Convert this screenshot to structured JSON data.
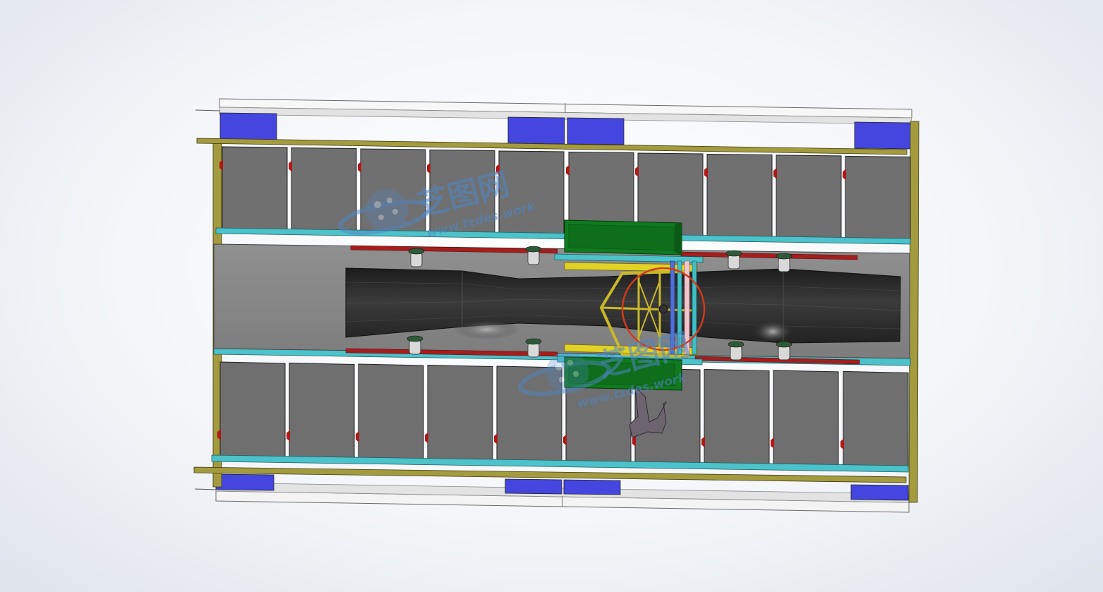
{
  "viewport": {
    "background": "#f4f6f9",
    "colors": {
      "frame_olive": "#a19a3c",
      "rail_cyan": "#4bc0c8",
      "pad_blue": "#4444dd",
      "panel_gray": "#6f6f6f",
      "bed_gray": "#888888",
      "duct_dark": "#2a2a2a",
      "bar_red": "#a51d1d",
      "cabinet_green": "#0f7a1e",
      "cart_yellow": "#e2d227",
      "ring_red": "#d23a1a"
    }
  },
  "watermarks": [
    {
      "brand": "芝图网",
      "url": "www.tzdes.work",
      "icon": "globe-logo-icon"
    },
    {
      "brand": "芝图网",
      "url": "www.tzdes.work",
      "icon": "globe-logo-icon"
    }
  ]
}
